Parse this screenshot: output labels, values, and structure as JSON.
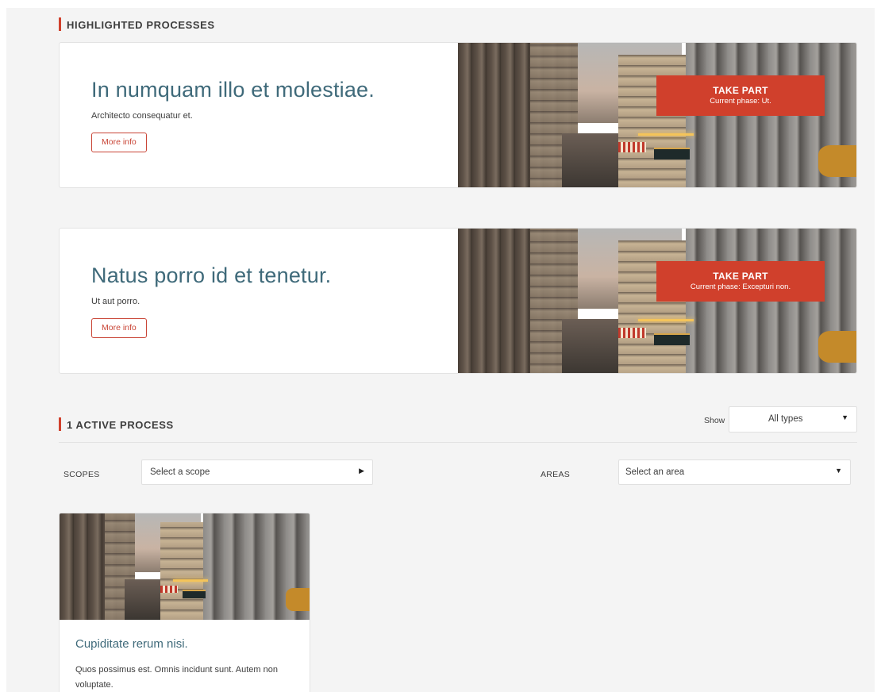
{
  "highlighted": {
    "section_title": "HIGHLIGHTED PROCESSES",
    "cards": [
      {
        "title": "In numquam illo et molestiae.",
        "description": "Architecto consequatur et.",
        "more_info": "More info",
        "take_part": "TAKE PART",
        "phase": "Current phase: Ut."
      },
      {
        "title": "Natus porro id et tenetur.",
        "description": "Ut aut porro.",
        "more_info": "More info",
        "take_part": "TAKE PART",
        "phase": "Current phase: Excepturi non."
      }
    ]
  },
  "active": {
    "section_title": "1 ACTIVE PROCESS",
    "show_label": "Show",
    "type_select": "All types"
  },
  "filters": {
    "scopes_label": "SCOPES",
    "scope_select": "Select a scope",
    "areas_label": "AREAS",
    "area_select": "Select an area"
  },
  "processes": [
    {
      "title": "Cupiditate rerum nisi.",
      "description": "Quos possimus est. Omnis incidunt sunt. Autem non voluptate."
    }
  ],
  "colors": {
    "accent": "#d0402c",
    "title_teal": "#3f6a7a",
    "background": "#f4f4f4"
  },
  "icons": {
    "dropdown": "caret-down-icon",
    "scope_arrow": "caret-right-icon"
  }
}
